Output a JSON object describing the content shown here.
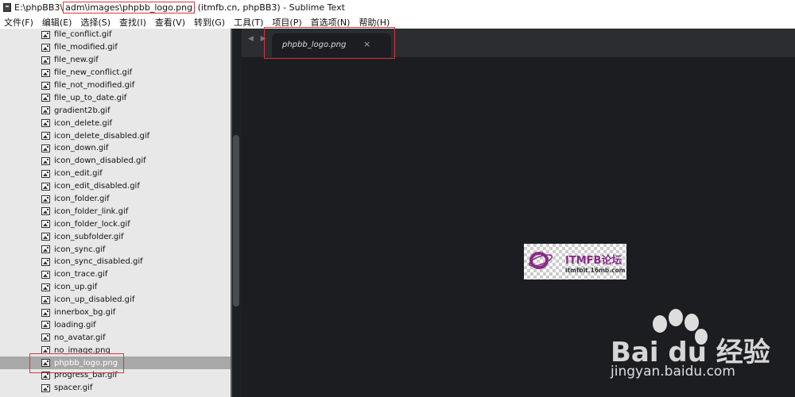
{
  "window": {
    "title_prefix": "E:\\phpBB3\\",
    "title_highlight": "adm\\images\\phpbb_logo.png",
    "title_suffix": " (itmfb.cn, phpBB3) - Sublime Text"
  },
  "menu": [
    {
      "label": "文件(F)"
    },
    {
      "label": "编辑(E)"
    },
    {
      "label": "选择(S)"
    },
    {
      "label": "查找(I)"
    },
    {
      "label": "查看(V)"
    },
    {
      "label": "转到(G)"
    },
    {
      "label": "工具(T)"
    },
    {
      "label": "项目(P)"
    },
    {
      "label": "首选项(N)"
    },
    {
      "label": "帮助(H)"
    }
  ],
  "sidebar": {
    "files": [
      {
        "name": "file_conflict.gif"
      },
      {
        "name": "file_modified.gif"
      },
      {
        "name": "file_new.gif"
      },
      {
        "name": "file_new_conflict.gif"
      },
      {
        "name": "file_not_modified.gif"
      },
      {
        "name": "file_up_to_date.gif"
      },
      {
        "name": "gradient2b.gif"
      },
      {
        "name": "icon_delete.gif"
      },
      {
        "name": "icon_delete_disabled.gif"
      },
      {
        "name": "icon_down.gif"
      },
      {
        "name": "icon_down_disabled.gif"
      },
      {
        "name": "icon_edit.gif"
      },
      {
        "name": "icon_edit_disabled.gif"
      },
      {
        "name": "icon_folder.gif"
      },
      {
        "name": "icon_folder_link.gif"
      },
      {
        "name": "icon_folder_lock.gif"
      },
      {
        "name": "icon_subfolder.gif"
      },
      {
        "name": "icon_sync.gif"
      },
      {
        "name": "icon_sync_disabled.gif"
      },
      {
        "name": "icon_trace.gif"
      },
      {
        "name": "icon_up.gif"
      },
      {
        "name": "icon_up_disabled.gif"
      },
      {
        "name": "innerbox_bg.gif"
      },
      {
        "name": "loading.gif"
      },
      {
        "name": "no_avatar.gif"
      },
      {
        "name": "no_image.png"
      },
      {
        "name": "phpbb_logo.png",
        "selected": true
      },
      {
        "name": "progress_bar.gif"
      },
      {
        "name": "spacer.gif"
      }
    ]
  },
  "editor": {
    "nav_arrows": "◀ ▶",
    "tab_label": "phpbb_logo.png",
    "tab_close": "×"
  },
  "preview": {
    "logo_title": "ITMFB论坛",
    "logo_subtitle": "itmfbit.16mb.com"
  },
  "watermark": {
    "brand": "Bai du 经验",
    "url": "jingyan.baidu.com"
  }
}
